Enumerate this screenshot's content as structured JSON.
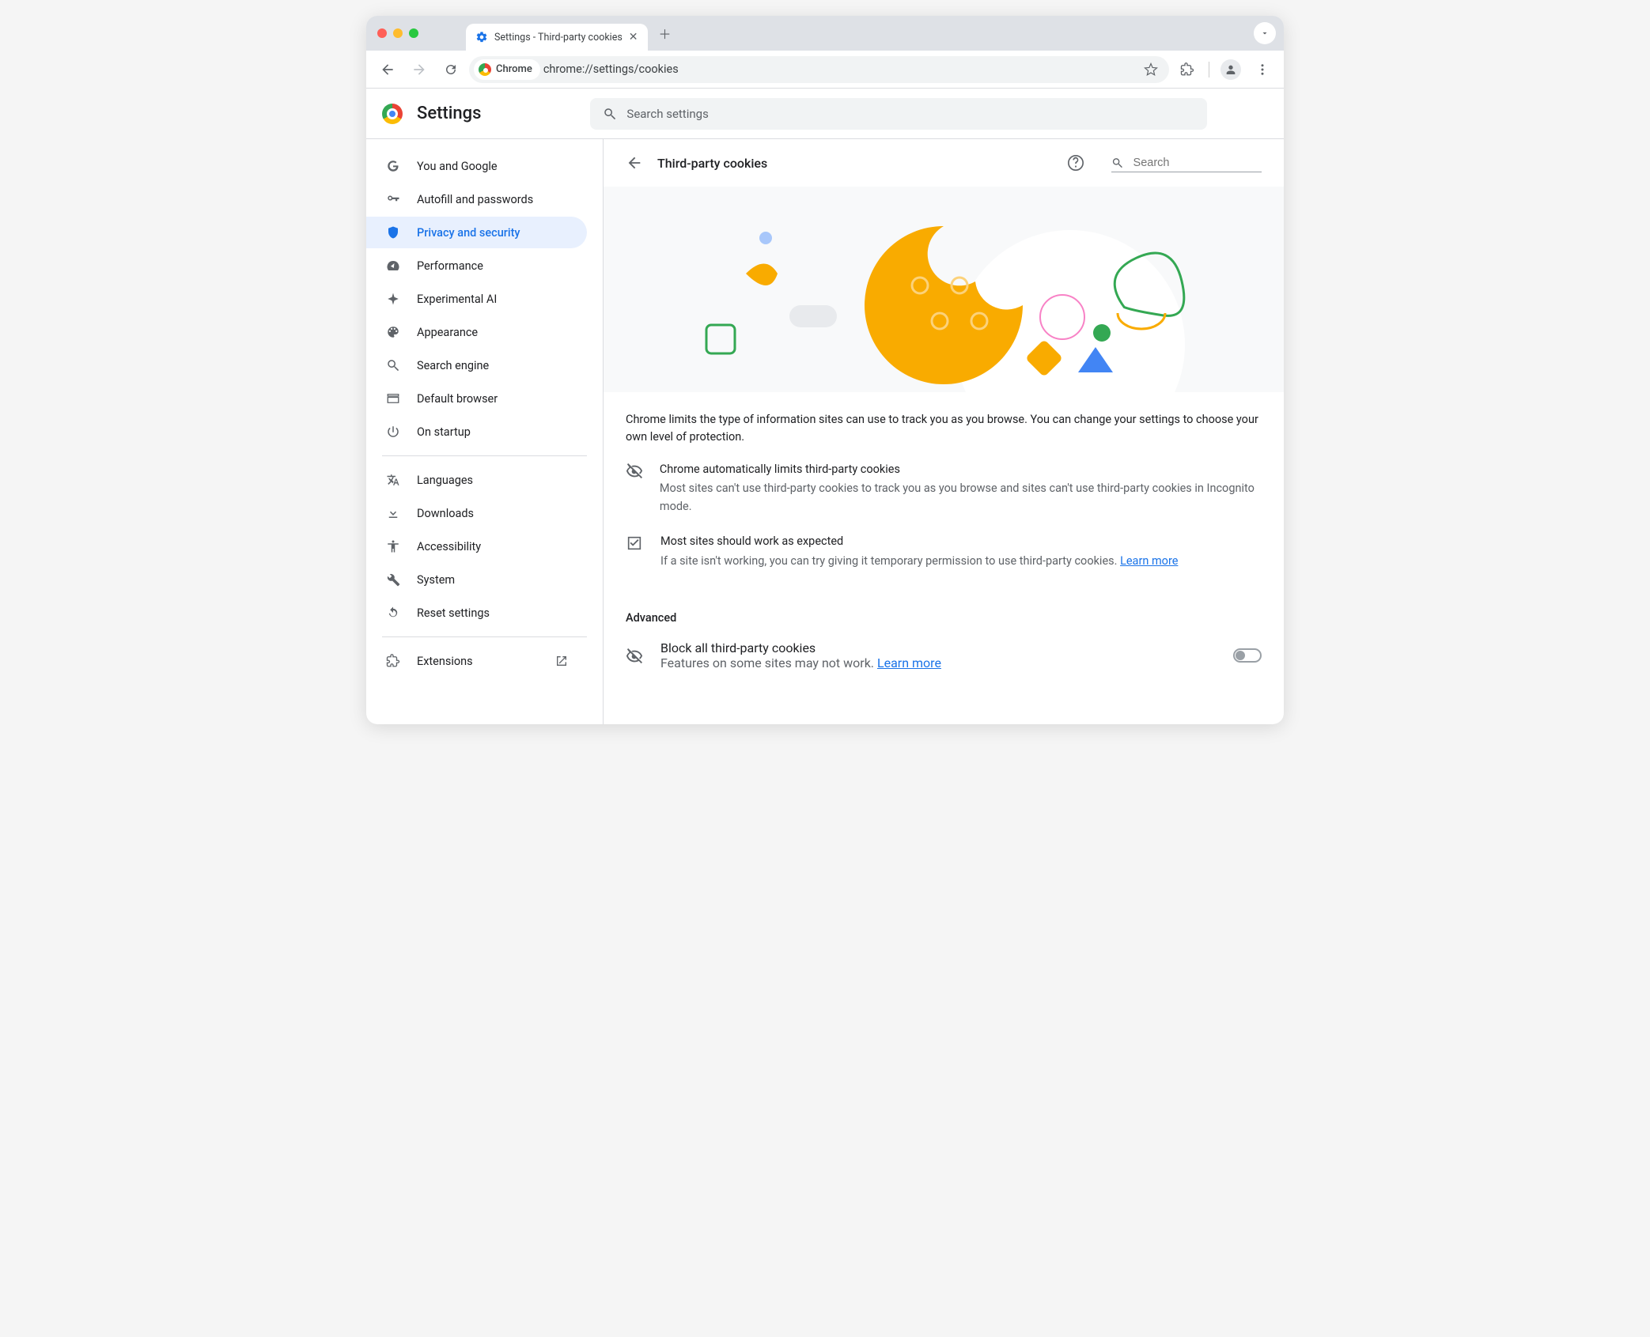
{
  "window": {
    "tab_title": "Settings - Third-party cookies"
  },
  "toolbar": {
    "chrome_chip": "Chrome",
    "url": "chrome://settings/cookies"
  },
  "header": {
    "app_title": "Settings",
    "search_placeholder": "Search settings"
  },
  "sidebar": {
    "items": [
      {
        "label": "You and Google"
      },
      {
        "label": "Autofill and passwords"
      },
      {
        "label": "Privacy and security"
      },
      {
        "label": "Performance"
      },
      {
        "label": "Experimental AI"
      },
      {
        "label": "Appearance"
      },
      {
        "label": "Search engine"
      },
      {
        "label": "Default browser"
      },
      {
        "label": "On startup"
      }
    ],
    "items2": [
      {
        "label": "Languages"
      },
      {
        "label": "Downloads"
      },
      {
        "label": "Accessibility"
      },
      {
        "label": "System"
      },
      {
        "label": "Reset settings"
      }
    ],
    "items3": [
      {
        "label": "Extensions"
      }
    ]
  },
  "page": {
    "title": "Third-party cookies",
    "search_placeholder": "Search",
    "lead": "Chrome limits the type of information sites can use to track you as you browse. You can change your settings to choose your own level of protection.",
    "info1": {
      "title": "Chrome automatically limits third-party cookies",
      "desc": "Most sites can't use third-party cookies to track you as you browse and sites can't use third-party cookies in Incognito mode."
    },
    "info2": {
      "title": "Most sites should work as expected",
      "desc": "If a site isn't working, you can try giving it temporary permission to use third-party cookies. ",
      "learn": "Learn more"
    },
    "advanced_label": "Advanced",
    "block": {
      "title": "Block all third-party cookies",
      "desc": "Features on some sites may not work. ",
      "learn": "Learn more"
    }
  }
}
